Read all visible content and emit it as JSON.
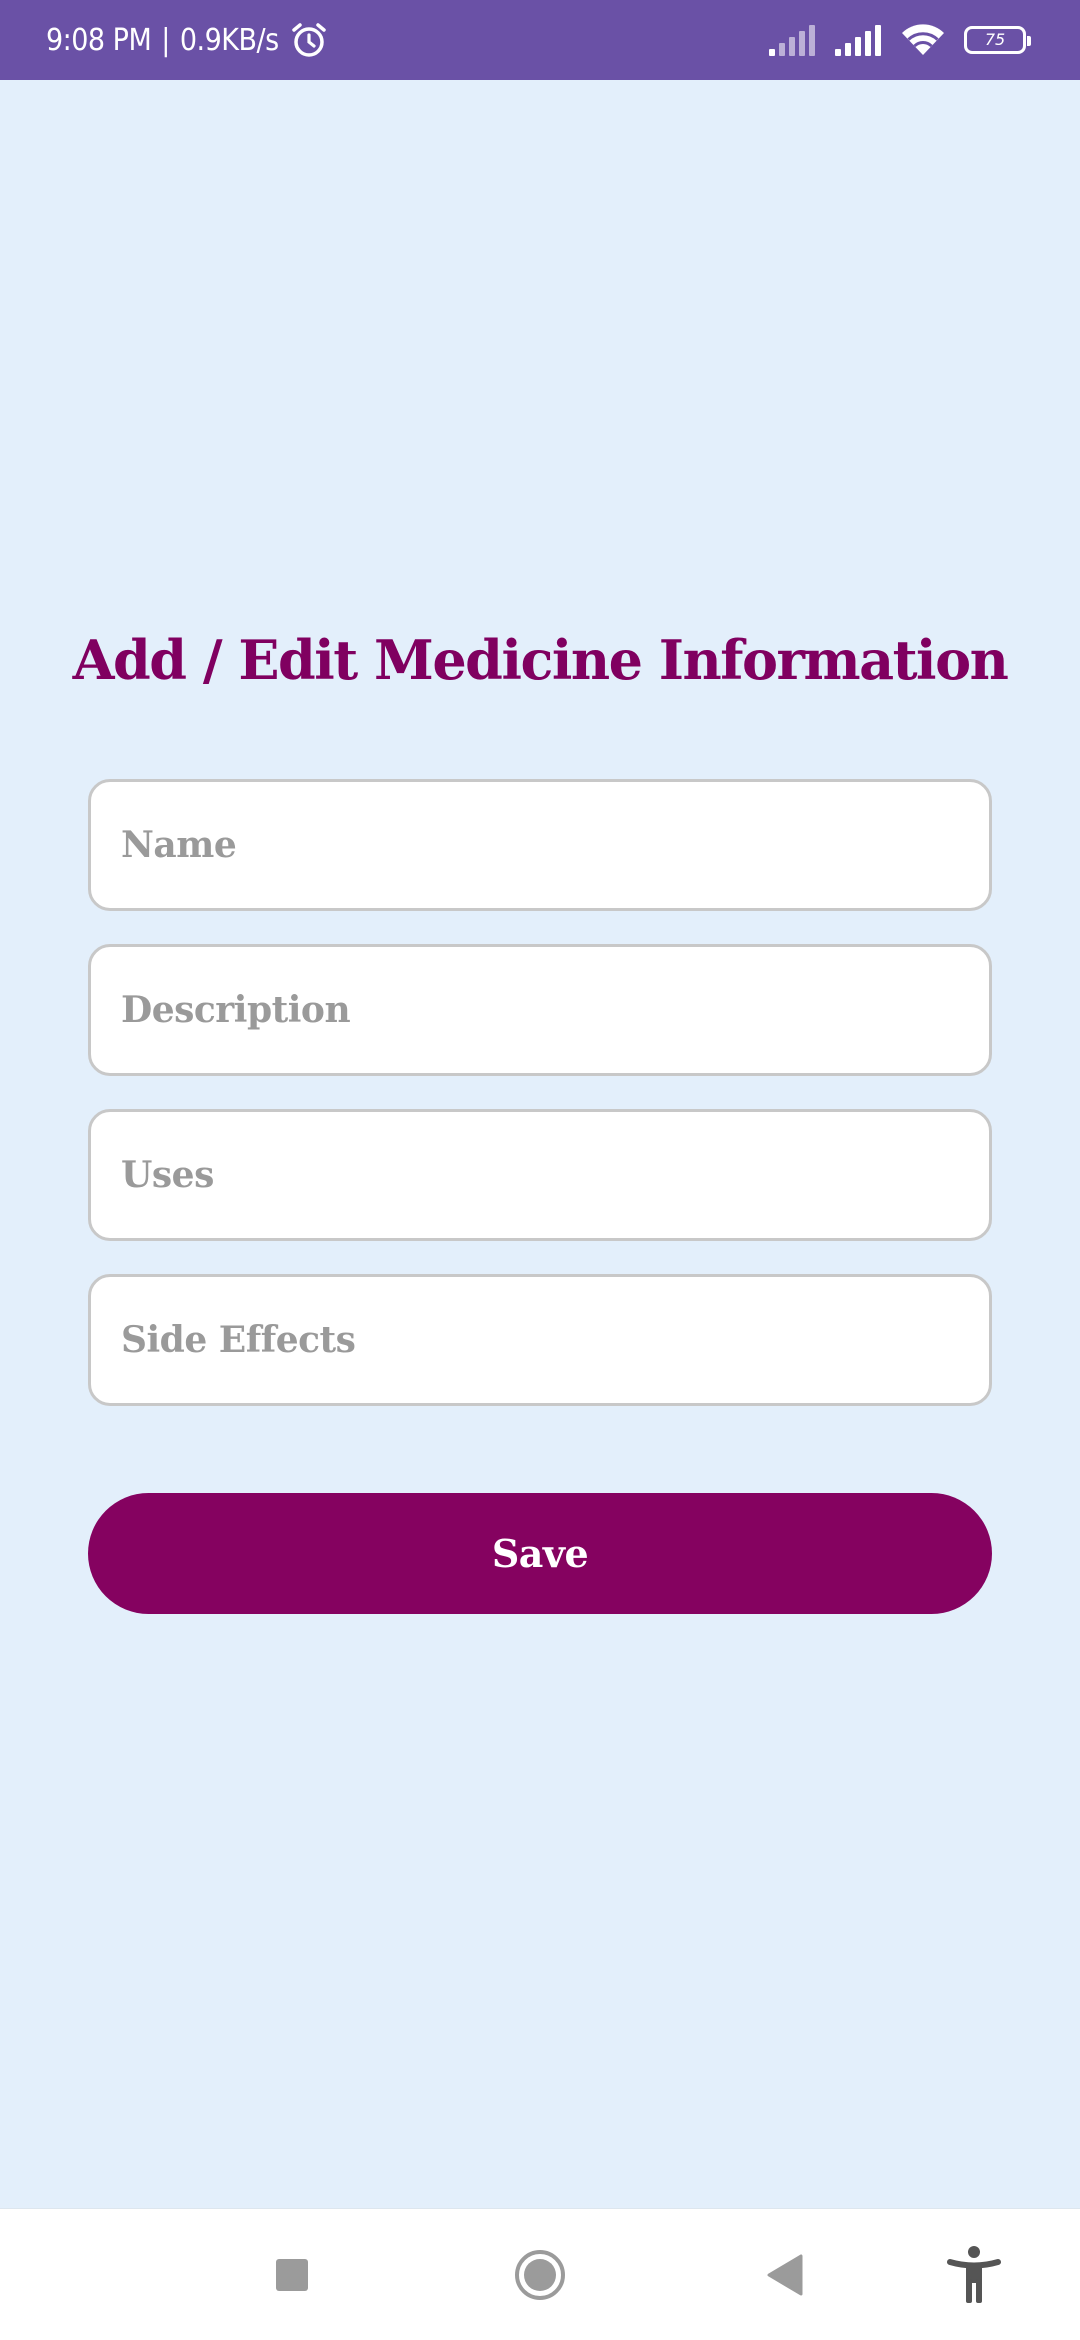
{
  "status_bar": {
    "time": "9:08 PM",
    "separator": "|",
    "network_speed": "0.9KB/s",
    "battery_level": "75",
    "icons": [
      "alarm-icon",
      "signal-weak-icon",
      "signal-icon",
      "wifi-icon",
      "battery-icon"
    ]
  },
  "form": {
    "title": "Add / Edit Medicine Information",
    "fields": {
      "name": {
        "value": "",
        "placeholder": "Name"
      },
      "description": {
        "value": "",
        "placeholder": "Description"
      },
      "uses": {
        "value": "",
        "placeholder": "Uses"
      },
      "side_effects": {
        "value": "",
        "placeholder": "Side Effects"
      }
    },
    "save_label": "Save"
  },
  "nav_bar": {
    "icons": [
      "recents-square-icon",
      "home-circle-icon",
      "back-triangle-icon",
      "accessibility-icon"
    ]
  },
  "colors": {
    "status_bar_bg": "#6a51a6",
    "page_bg": "#e3effb",
    "accent": "#850260",
    "placeholder": "#9a9a9a"
  }
}
